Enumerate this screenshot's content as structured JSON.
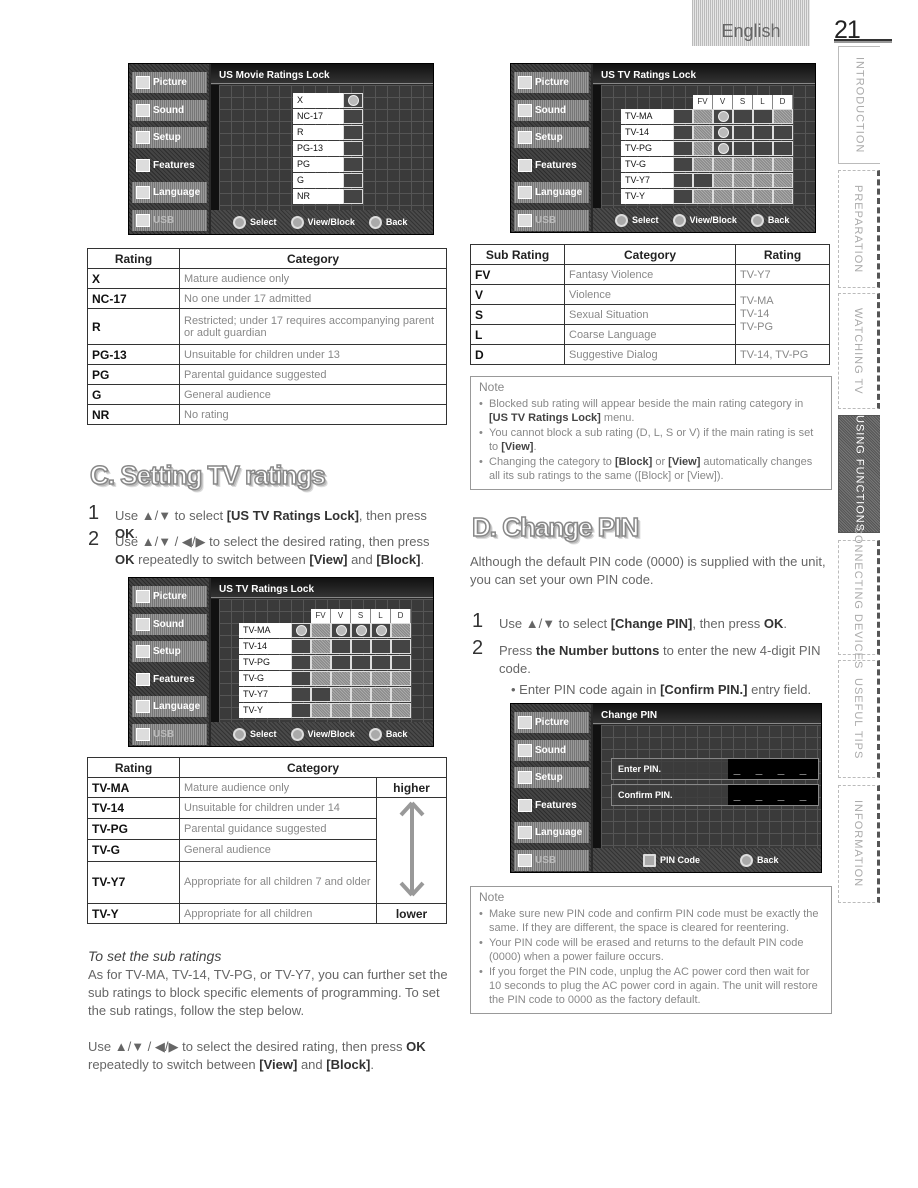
{
  "header": {
    "language": "English",
    "page_number": "21"
  },
  "side_tabs": [
    {
      "label": "INTRODUCTION",
      "active": false
    },
    {
      "label": "PREPARATION",
      "active": false
    },
    {
      "label": "WATCHING TV",
      "active": false
    },
    {
      "label": "USING FUNCTIONS",
      "active": true
    },
    {
      "label": "CONNECTING DEVICES",
      "active": false
    },
    {
      "label": "USEFUL TIPS",
      "active": false
    },
    {
      "label": "INFORMATION",
      "active": false
    }
  ],
  "tv_menu": [
    "Picture",
    "Sound",
    "Setup",
    "Features",
    "Language",
    "USB"
  ],
  "movie_screen": {
    "title": "US Movie Ratings Lock",
    "ratings": [
      "X",
      "NC-17",
      "R",
      "PG-13",
      "PG",
      "G",
      "NR"
    ],
    "locked": [
      true,
      false,
      false,
      false,
      false,
      false,
      false
    ],
    "footer": {
      "select": "Select",
      "view_block": "View/Block",
      "back": "Back"
    }
  },
  "movie_table": {
    "headers": [
      "Rating",
      "Category"
    ],
    "rows": [
      [
        "X",
        "Mature audience only"
      ],
      [
        "NC-17",
        "No one under 17 admitted"
      ],
      [
        "R",
        "Restricted; under 17 requires accompanying parent or adult guardian"
      ],
      [
        "PG-13",
        "Unsuitable for children under 13"
      ],
      [
        "PG",
        "Parental guidance suggested"
      ],
      [
        "G",
        "General audience"
      ],
      [
        "NR",
        "No rating"
      ]
    ]
  },
  "section_c": {
    "title": "C. Setting TV ratings",
    "step1": {
      "num": "1",
      "pre": "Use ▲/▼ to select ",
      "target": "[US TV Ratings Lock]",
      "mid": ", then press ",
      "key": "OK",
      "post": "."
    },
    "step2": {
      "num": "2",
      "pre": "Use ▲/▼ / ◀/▶ to select the desired rating, then press ",
      "key": "OK",
      "mid": " repeatedly to switch between ",
      "v": "[View]",
      "and": " and ",
      "b": "[Block]",
      "post": "."
    }
  },
  "tv_screen_1": {
    "title": "US TV Ratings Lock",
    "sub_headers": [
      "FV",
      "V",
      "S",
      "L",
      "D"
    ],
    "ratings": [
      "TV-MA",
      "TV-14",
      "TV-PG",
      "TV-G",
      "TV-Y7",
      "TV-Y"
    ],
    "main_locked": [
      true,
      false,
      false,
      false,
      false,
      false
    ],
    "sub_states": [
      [
        "na",
        "lock",
        "lock",
        "lock",
        "na"
      ],
      [
        "na",
        "open",
        "open",
        "open",
        "open"
      ],
      [
        "na",
        "open",
        "open",
        "open",
        "open"
      ],
      [
        "na",
        "na",
        "na",
        "na",
        "na"
      ],
      [
        "open",
        "na",
        "na",
        "na",
        "na"
      ],
      [
        "na",
        "na",
        "na",
        "na",
        "na"
      ]
    ],
    "footer": {
      "select": "Select",
      "view_block": "View/Block",
      "back": "Back"
    }
  },
  "tv_table": {
    "headers": [
      "Rating",
      "Category"
    ],
    "rows": [
      [
        "TV-MA",
        "Mature audience only"
      ],
      [
        "TV-14",
        "Unsuitable for children under 14"
      ],
      [
        "TV-PG",
        "Parental guidance suggested"
      ],
      [
        "TV-G",
        "General audience"
      ],
      [
        "TV-Y7",
        "Appropriate for all children 7 and older"
      ],
      [
        "TV-Y",
        "Appropriate for all children"
      ]
    ],
    "higher": "higher",
    "lower": "lower"
  },
  "sub_ratings_section": {
    "title": "To set the sub ratings",
    "body": "As for TV-MA, TV-14, TV-PG, or TV-Y7, you can further set the sub ratings to block specific elements of programming. To set the sub ratings, follow the step below.",
    "step_pre": "Use ▲/▼ / ◀/▶ to select the desired rating, then press ",
    "step_key": "OK",
    "step_mid": " repeatedly to switch between ",
    "step_v": "[View]",
    "step_and": " and ",
    "step_b": "[Block]",
    "step_post": "."
  },
  "tv_screen_2": {
    "title": "US TV Ratings Lock",
    "sub_headers": [
      "FV",
      "V",
      "S",
      "L",
      "D"
    ],
    "ratings": [
      "TV-MA",
      "TV-14",
      "TV-PG",
      "TV-G",
      "TV-Y7",
      "TV-Y"
    ],
    "main_locked": [
      false,
      false,
      false,
      false,
      false,
      false
    ],
    "sub_states": [
      [
        "na",
        "lock",
        "open",
        "open",
        "na"
      ],
      [
        "na",
        "lock",
        "open",
        "open",
        "open"
      ],
      [
        "na",
        "lock",
        "open",
        "open",
        "open"
      ],
      [
        "na",
        "na",
        "na",
        "na",
        "na"
      ],
      [
        "open",
        "na",
        "na",
        "na",
        "na"
      ],
      [
        "na",
        "na",
        "na",
        "na",
        "na"
      ]
    ],
    "footer": {
      "select": "Select",
      "view_block": "View/Block",
      "back": "Back"
    }
  },
  "sub_table": {
    "headers": [
      "Sub Rating",
      "Category",
      "Rating"
    ],
    "rows": [
      [
        "FV",
        "Fantasy Violence",
        "TV-Y7"
      ],
      [
        "V",
        "Violence",
        "TV-MA\nTV-14\nTV-PG"
      ],
      [
        "S",
        "Sexual Situation",
        ""
      ],
      [
        "L",
        "Coarse Language",
        ""
      ],
      [
        "D",
        "Suggestive Dialog",
        "TV-14, TV-PG"
      ]
    ]
  },
  "note1": {
    "title": "Note",
    "items": [
      {
        "pre": "Blocked sub rating will appear beside the main rating category in ",
        "b": "[US TV Ratings Lock]",
        "post": " menu."
      },
      {
        "pre": "You cannot block a sub rating (D, L, S or V) if the main rating is set to ",
        "b": "[View]",
        "post": "."
      },
      {
        "pre": "Changing the category to ",
        "b": "[Block]",
        "mid": " or ",
        "b2": "[View]",
        "post": " automatically changes all its sub ratings to the same ([Block] or [View])."
      }
    ]
  },
  "section_d": {
    "title": "D. Change PIN",
    "intro": "Although the default PIN code (0000) is supplied with the unit, you can set your own PIN code.",
    "step1": {
      "num": "1",
      "pre": "Use ▲/▼ to select ",
      "target": "[Change PIN]",
      "mid": ", then press ",
      "key": "OK",
      "post": "."
    },
    "step2": {
      "num": "2",
      "pre": "Press ",
      "key": "the Number buttons",
      "post": " to enter the new 4-digit PIN code."
    },
    "bullet": {
      "pre": "Enter PIN code again in ",
      "b": "[Confirm PIN.]",
      "post": " entry field."
    }
  },
  "pin_screen": {
    "title": "Change PIN",
    "enter_label": "Enter PIN.",
    "confirm_label": "Confirm PIN.",
    "enter_value": "_ _ _ _",
    "confirm_value": "_ _ _ _",
    "footer": {
      "pin_code": "PIN Code",
      "back": "Back"
    }
  },
  "note2": {
    "title": "Note",
    "items": [
      "Make sure new PIN code and confirm PIN code must be exactly the same. If they are different, the space is cleared for reentering.",
      "Your PIN code will be erased and returns to the default PIN code (0000) when a power failure occurs.",
      "If you forget the PIN code, unplug the AC power cord then wait for 10 seconds to plug the AC power cord in again. The unit will restore the PIN code to 0000 as the factory default."
    ]
  }
}
